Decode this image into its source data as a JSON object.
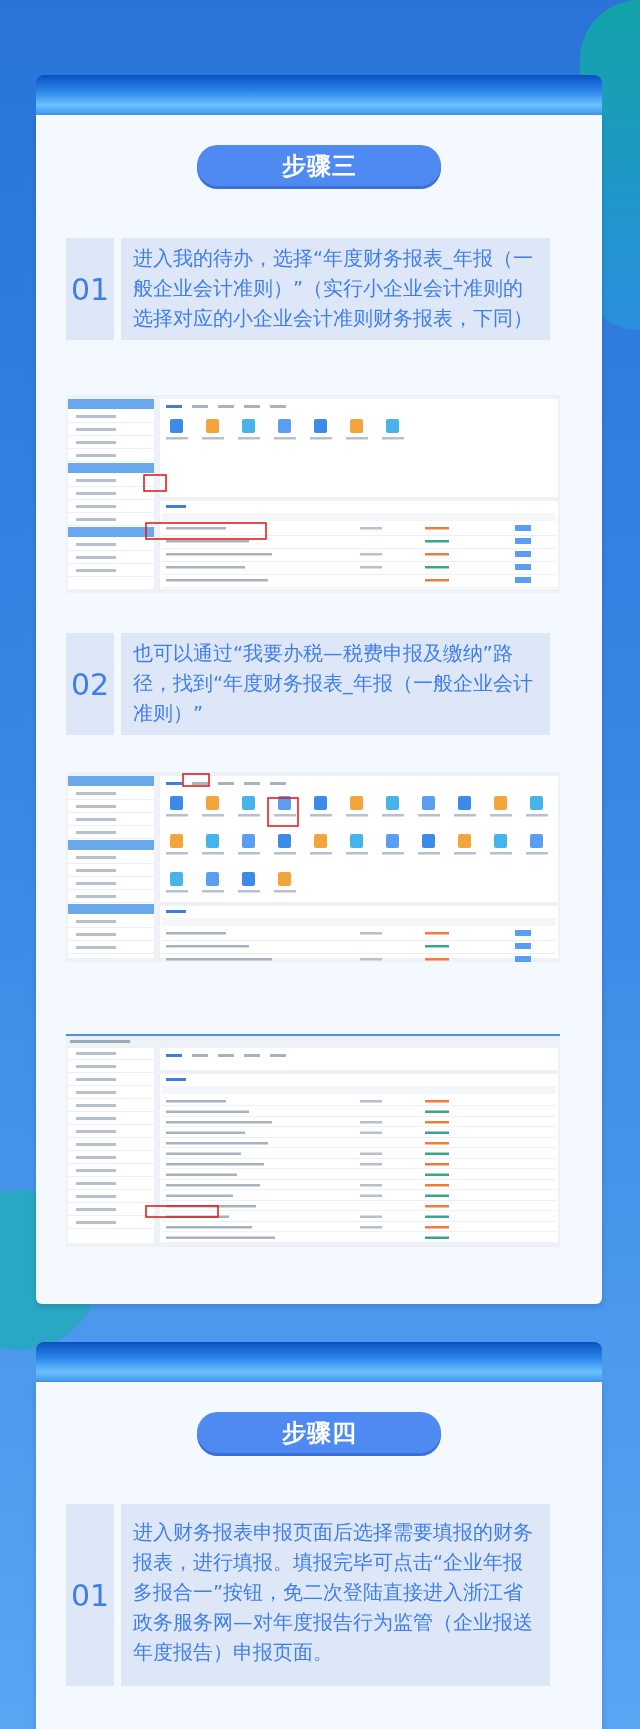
{
  "sections": [
    {
      "title": "步骤三",
      "blocks": [
        {
          "kind": "step",
          "number": "01",
          "text": "进入我的待办，选择“年度财务报表_年报（一般企业会计准则）”（实行小企业会计准则的选择对应的小企业会计准则财务报表，下同）"
        },
        {
          "kind": "screenshot"
        },
        {
          "kind": "step",
          "number": "02",
          "text": "也可以通过“我要办税—税费申报及缴纳”路径，找到“年度财务报表_年报（一般企业会计准则）”"
        },
        {
          "kind": "screenshot"
        },
        {
          "kind": "screenshot"
        }
      ]
    },
    {
      "title": "步骤四",
      "blocks": [
        {
          "kind": "step",
          "number": "01",
          "text": "进入财务报表申报页面后选择需要填报的财务报表，进行填报。填报完毕可点击“企业年报多报合一”按钮，免二次登陆直接进入浙江省政务服务网—对年度报告行为监管（企业报送年度报告）申报页面。"
        }
      ]
    }
  ]
}
